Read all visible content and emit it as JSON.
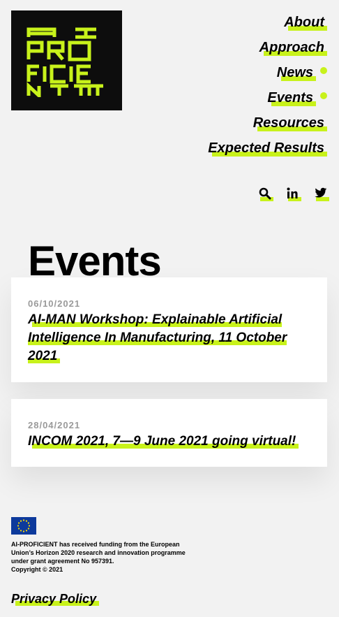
{
  "logo": {
    "name": "logo-ai-proficient"
  },
  "nav": {
    "items": [
      {
        "label": "About",
        "has_dot": false
      },
      {
        "label": "Approach",
        "has_dot": false
      },
      {
        "label": "News",
        "has_dot": true
      },
      {
        "label": "Events",
        "has_dot": true
      },
      {
        "label": "Resources",
        "has_dot": false
      },
      {
        "label": "Expected Results",
        "has_dot": false
      }
    ]
  },
  "social": {
    "icons": [
      "search-icon",
      "linkedin-icon",
      "twitter-icon"
    ]
  },
  "page": {
    "title": "Events"
  },
  "events": [
    {
      "date": "06/10/2021",
      "title": "AI-MAN Workshop: Explainable Artificial Intelligence In Manufacturing, 11 October 2021"
    },
    {
      "date": "28/04/2021",
      "title": "INCOM 2021, 7—9 June 2021 going virtual!"
    }
  ],
  "footer": {
    "funding_text": "AI-PROFICIENT has received funding from the European Union’s Horizon 2020 research and innovation programme under grant agreement No 957391.",
    "copyright": "Copyright © 2021",
    "privacy_label": "Privacy Policy"
  },
  "colors": {
    "accent": "#c8f21b",
    "logo_bg": "#0d0d0d",
    "eu_blue": "#0d3a9c",
    "eu_star": "#ffdd00"
  }
}
